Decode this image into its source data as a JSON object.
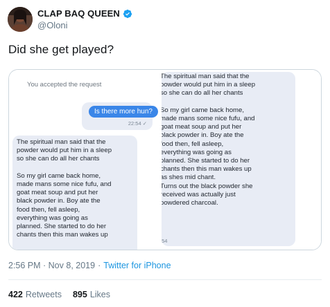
{
  "author": {
    "display_name": "CLAP BAQ QUEEN",
    "handle": "@Oloni",
    "verified": true
  },
  "tweet": {
    "text": "Did she get played?",
    "timestamp": "2:56 PM · Nov 8, 2019",
    "separator": "·",
    "source": "Twitter for iPhone"
  },
  "screenshot": {
    "left": {
      "system_note": "You accepted the request",
      "sent_message": "Is there more hun?",
      "sent_time": "22:54 ✓",
      "received_message": "The spiritual man said that the\npowder would put him in a sleep\nso she can do all her chants\n\nSo my girl came back home,\nmade mans some nice fufu, and\ngoat meat soup and put her\nblack powder in. Boy ate the\nfood then, fell asleep,\neverything was going as\nplanned. She started to do her\nchants then this man wakes up"
    },
    "right": {
      "received_message": "The spiritual man said that the\npowder would put him in a sleep\nso she can do all her chants\n\nSo my girl came back home,\nmade mans some nice fufu, and\ngoat meat soup and put her\nblack powder in. Boy ate the\nfood then, fell asleep,\neverything was going as\nplanned. She started to do her\nchants then this man wakes up\nas shes mid chant.\nTurns out the black powder she\nreceived was actually just\npowdered charcoal.",
      "time": ":54"
    }
  },
  "stats": {
    "retweets_count": "422",
    "retweets_label": "Retweets",
    "likes_count": "895",
    "likes_label": "Likes"
  },
  "colors": {
    "link": "#1b95e0",
    "verified": "#1da1f2",
    "sent_bubble": "#3a86e8",
    "bubble_bg": "#e8ecf5"
  },
  "icons": {
    "verified": "verified-badge-icon"
  }
}
